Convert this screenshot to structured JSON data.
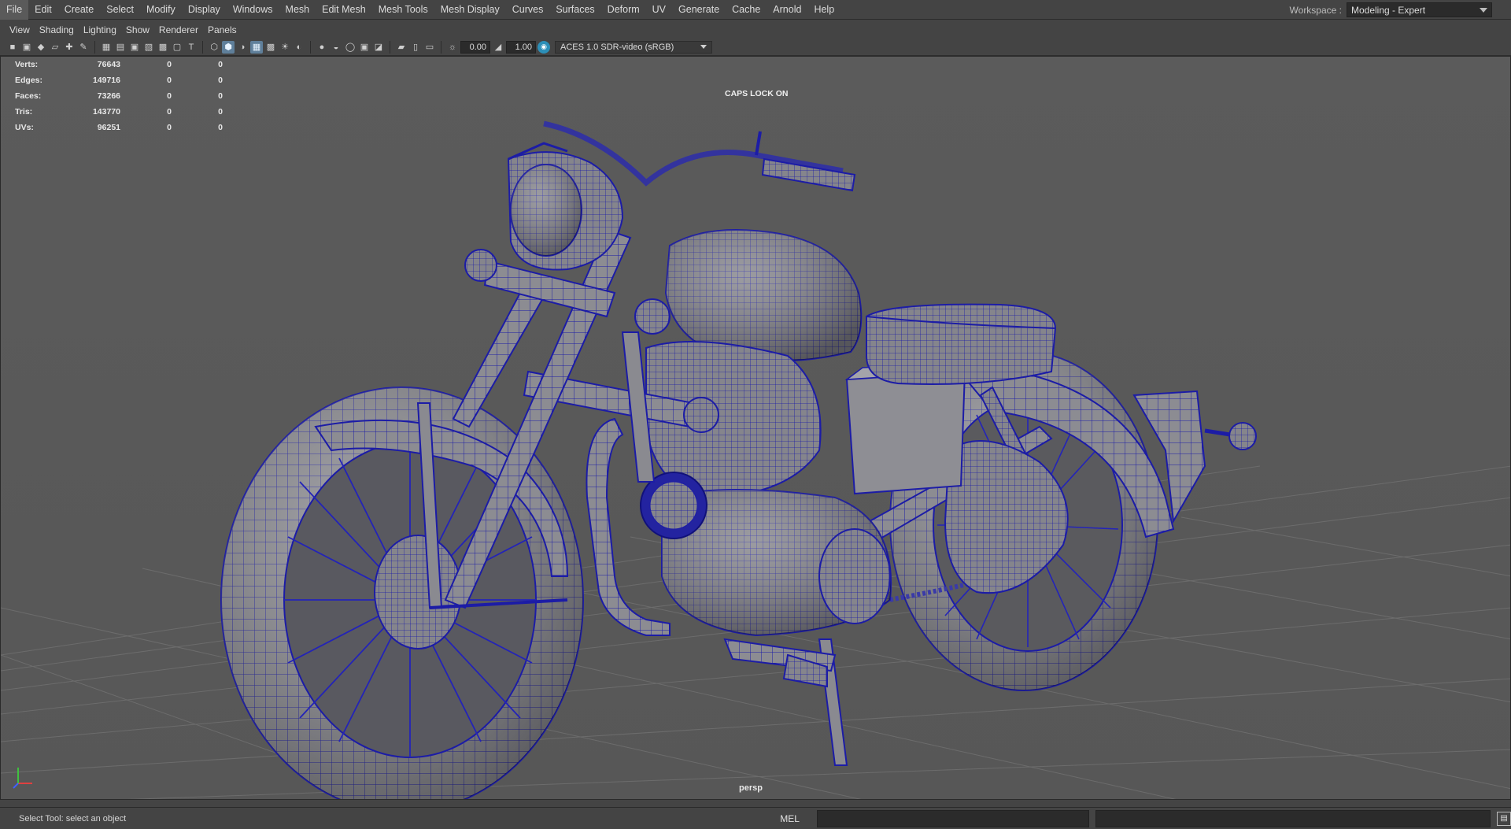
{
  "menubar": {
    "items": [
      "File",
      "Edit",
      "Create",
      "Select",
      "Modify",
      "Display",
      "Windows",
      "Mesh",
      "Edit Mesh",
      "Mesh Tools",
      "Mesh Display",
      "Curves",
      "Surfaces",
      "Deform",
      "UV",
      "Generate",
      "Cache",
      "Arnold",
      "Help"
    ]
  },
  "workspace": {
    "label": "Workspace :",
    "value": "Modeling - Expert"
  },
  "panel_menu": {
    "items": [
      "View",
      "Shading",
      "Lighting",
      "Show",
      "Renderer",
      "Panels"
    ]
  },
  "toolbar": {
    "icons": [
      "camera-select-icon",
      "camera-attributes-icon",
      "bookmarks-icon",
      "image-plane-icon",
      "grid-icon",
      "film-gate-icon",
      "resolution-gate-icon",
      "gate-mask-icon",
      "field-chart-icon",
      "safe-action-icon",
      "safe-title-icon",
      "wireframe-icon",
      "smooth-shade-icon",
      "default-material-icon",
      "wireframe-on-shaded-icon",
      "textured-icon",
      "use-all-lights-icon",
      "shadows-icon",
      "ambient-occlusion-icon",
      "motion-blur-icon",
      "anti-aliasing-icon",
      "isolate-select-icon",
      "xray-icon",
      "xray-active-components-icon",
      "xray-joints-icon",
      "backface-culling-icon"
    ],
    "exposure_value": "0.00",
    "gamma_value": "1.00",
    "color_space": "ACES 1.0 SDR-video (sRGB)"
  },
  "hud": {
    "stats": [
      {
        "label": "Verts:",
        "v1": "76643",
        "v2": "0",
        "v3": "0"
      },
      {
        "label": "Edges:",
        "v1": "149716",
        "v2": "0",
        "v3": "0"
      },
      {
        "label": "Faces:",
        "v1": "73266",
        "v2": "0",
        "v3": "0"
      },
      {
        "label": "Tris:",
        "v1": "143770",
        "v2": "0",
        "v3": "0"
      },
      {
        "label": "UVs:",
        "v1": "96251",
        "v2": "0",
        "v3": "0"
      }
    ],
    "caps_lock": "CAPS LOCK ON",
    "camera": "persp"
  },
  "colors": {
    "viewport_bg": "#585858",
    "wire": "#1a1aa0",
    "mesh_fill": "#8b8b90",
    "grid": "#6d6d6d"
  },
  "statusbar": {
    "help_text": "Select Tool: select an object",
    "command_language": "MEL"
  }
}
